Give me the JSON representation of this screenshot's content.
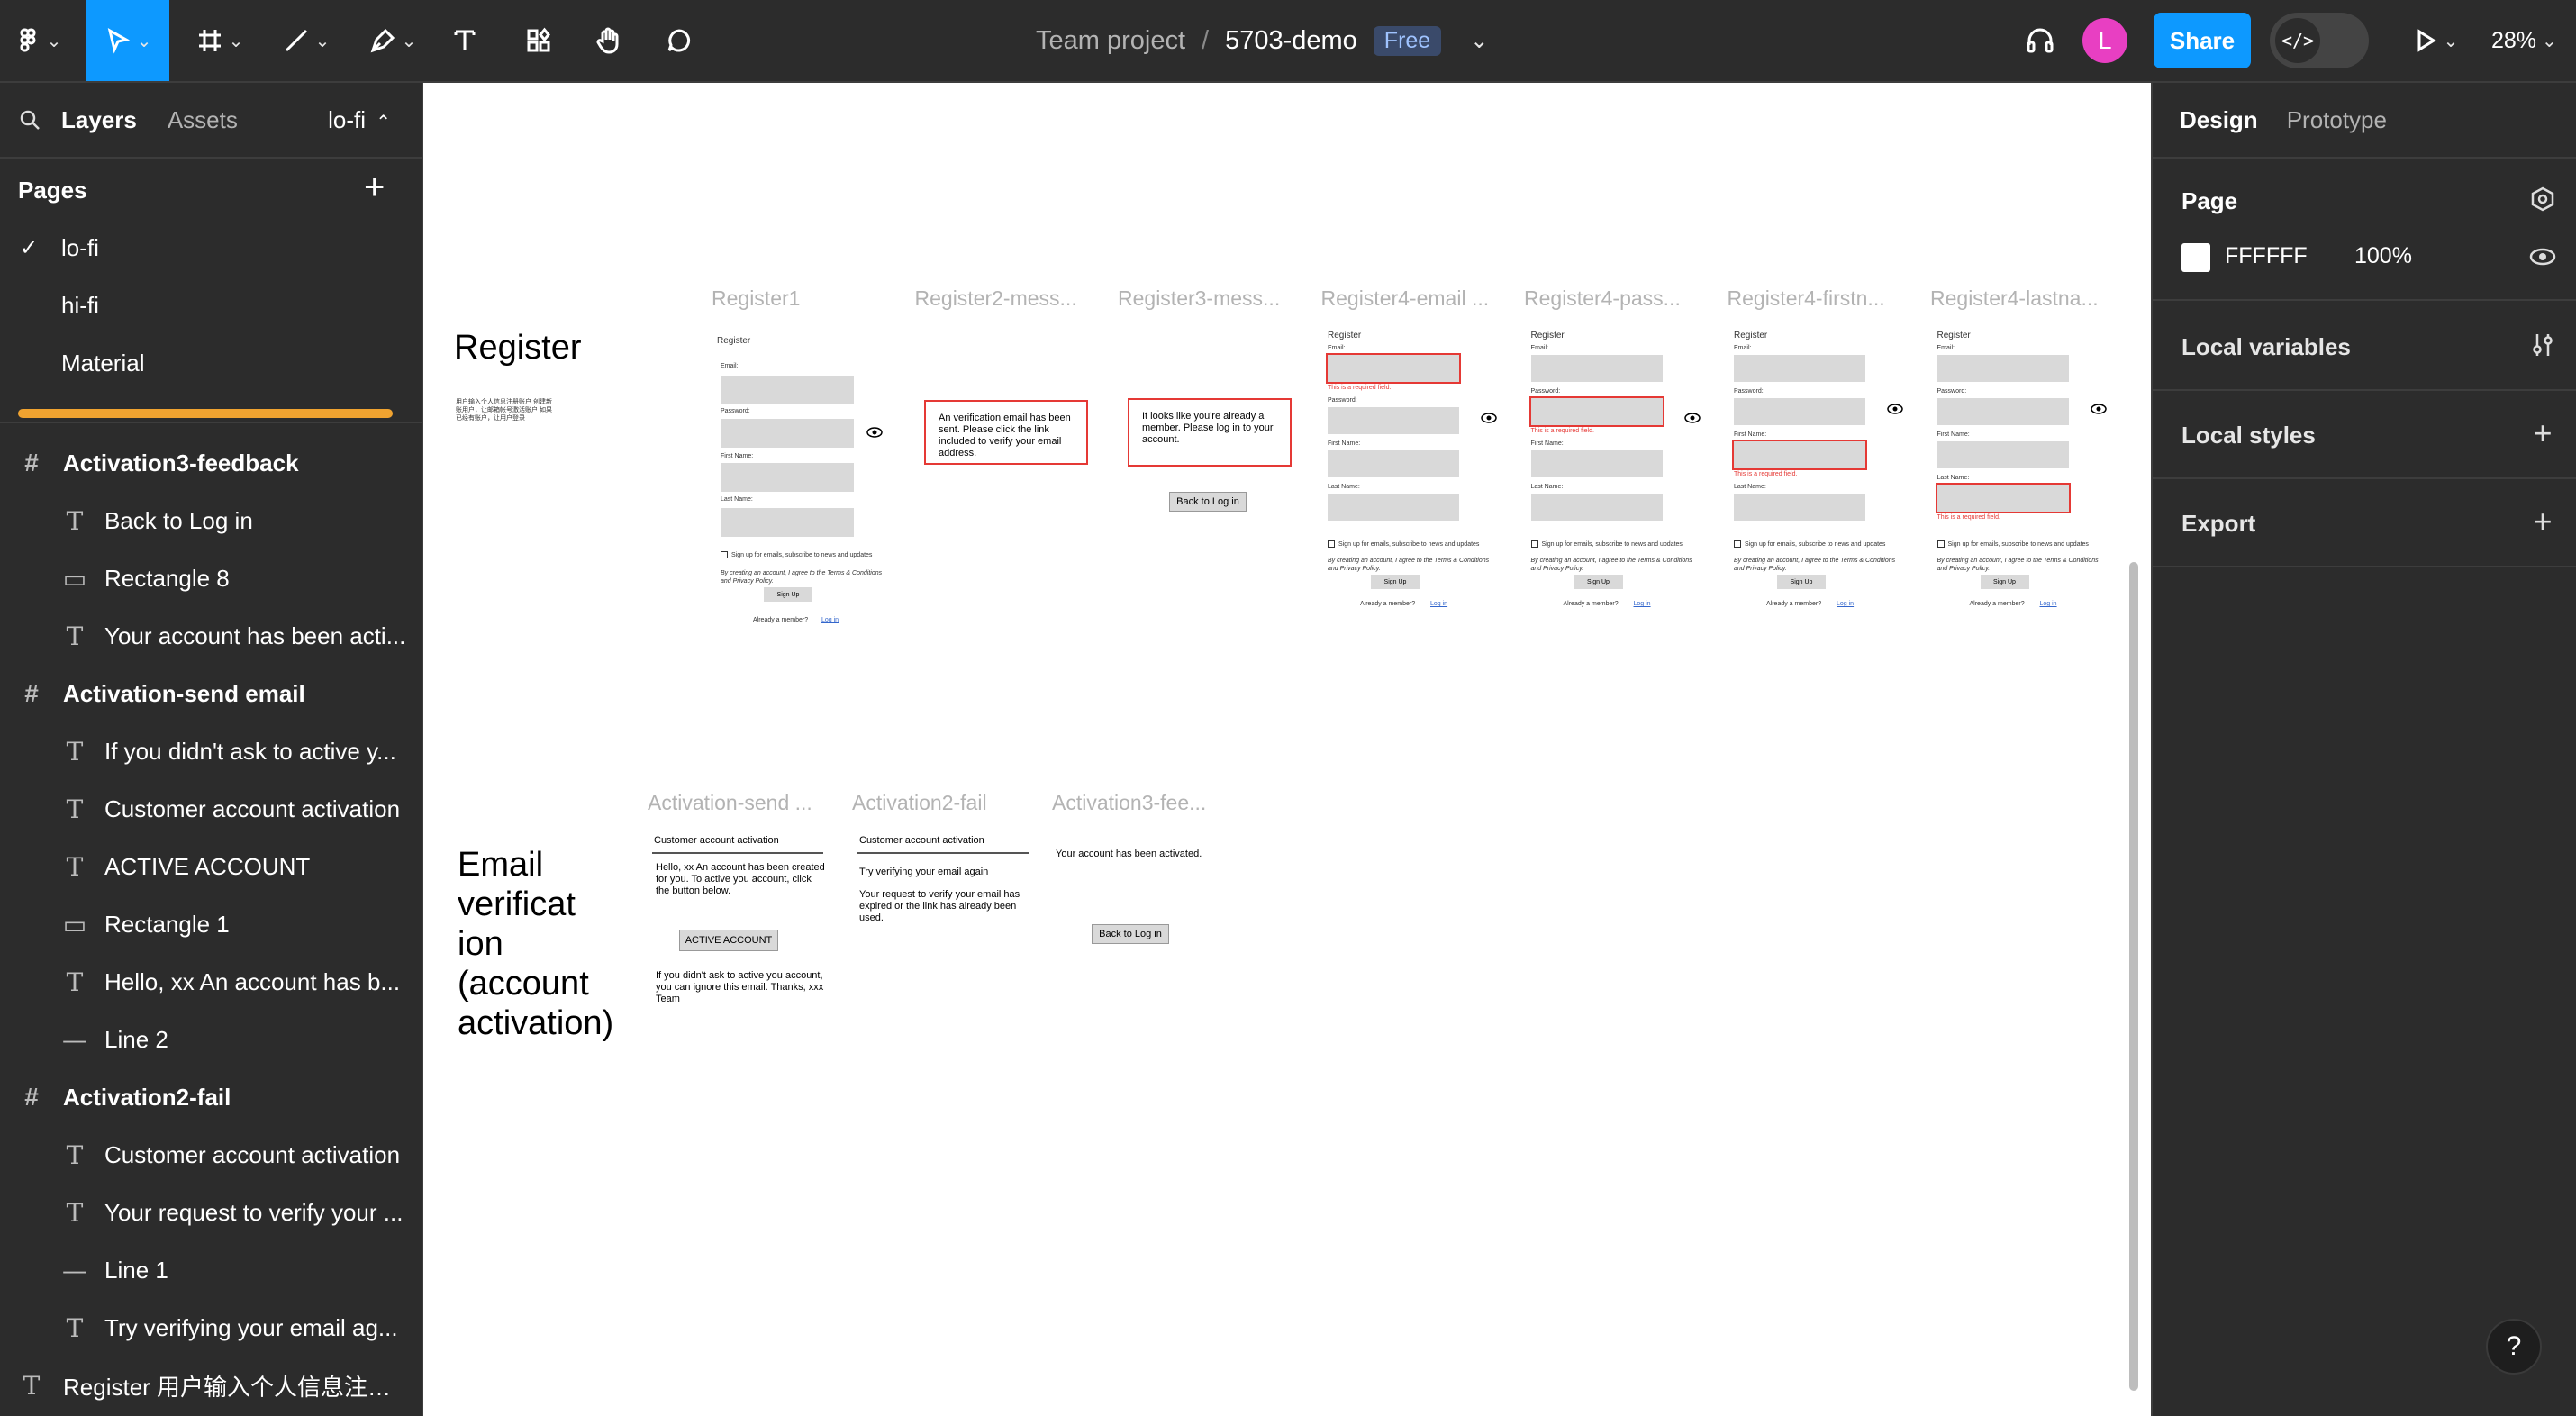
{
  "toolbar": {
    "breadcrumb_team": "Team project",
    "breadcrumb_sep": "/",
    "file_name": "5703-demo",
    "plan_badge": "Free",
    "avatar_initial": "L",
    "share_label": "Share",
    "dev_mode_label": "</>",
    "zoom_level": "28%",
    "caret": "⌄",
    "icons": [
      "main-menu-icon",
      "move-tool-icon",
      "frame-tool-icon",
      "line-tool-icon",
      "pen-tool-icon",
      "text-tool-icon",
      "resources-icon",
      "hand-tool-icon",
      "comment-icon",
      "headphones-icon",
      "present-icon"
    ]
  },
  "left_panel": {
    "tab_layers": "Layers",
    "tab_assets": "Assets",
    "current_page": "lo-fi",
    "current_page_caret": "⌃",
    "pages_heading": "Pages",
    "add_page": "+",
    "pages": [
      {
        "label": "lo-fi",
        "selected": true
      },
      {
        "label": "hi-fi",
        "selected": false
      },
      {
        "label": "Material",
        "selected": false
      }
    ],
    "layers": [
      {
        "type": "frame",
        "label": "Activation3-feedback"
      },
      {
        "type": "text",
        "label": "Back to Log in"
      },
      {
        "type": "rect",
        "label": "Rectangle 8"
      },
      {
        "type": "text",
        "label": "Your account has been acti..."
      },
      {
        "type": "frame",
        "label": "Activation-send email"
      },
      {
        "type": "text",
        "label": "If you didn't ask to active y..."
      },
      {
        "type": "text",
        "label": "Customer account activation"
      },
      {
        "type": "text",
        "label": "ACTIVE ACCOUNT"
      },
      {
        "type": "rect",
        "label": "Rectangle 1"
      },
      {
        "type": "text",
        "label": "Hello, xx An account has b..."
      },
      {
        "type": "line",
        "label": "Line 2"
      },
      {
        "type": "frame",
        "label": "Activation2-fail"
      },
      {
        "type": "text",
        "label": "Customer account activation"
      },
      {
        "type": "text",
        "label": "Your request to verify your ..."
      },
      {
        "type": "line",
        "label": "Line 1"
      },
      {
        "type": "text",
        "label": "Try verifying your email ag..."
      },
      {
        "type": "roottext",
        "label": "Register 用户输入个人信息注册..."
      }
    ]
  },
  "canvas": {
    "register_title": "Register",
    "register_note": "用户输入个人信息注册账户 创建新账用户，让邮箱帐号激活账户 如果已经有账户，让用户登录",
    "email_title": "Email verificat ion (account activation)",
    "register_frames": [
      "Register1",
      "Register2-mess...",
      "Register3-mess...",
      "Register4-email ...",
      "Register4-pass...",
      "Register4-firstn...",
      "Register4-lastna..."
    ],
    "activation_frames": [
      "Activation-send ...",
      "Activation2-fail",
      "Activation3-fee..."
    ],
    "form": {
      "heading": "Register",
      "email": "Email:",
      "password": "Password:",
      "first_name": "First Name:",
      "last_name": "Last Name:",
      "checkbox": "Sign up for emails, subscribe to news and updates",
      "terms": "By creating an account, I agree to the Terms & Conditions and Privacy Policy.",
      "signup": "Sign Up",
      "already": "Already a member?",
      "login": "Log in",
      "required": "This is a required field."
    },
    "msg_sent": "An verification email has been sent. Please click the link included to verify your email address.",
    "msg_member": "It looks like you're already a member. Please log in to your account.",
    "back_to_login": "Back to Log in",
    "act_send": {
      "header": "Customer account activation",
      "body": "Hello, xx An account has been created for you. To active you account, click the button below.",
      "button": "ACTIVE ACCOUNT",
      "footer": "If you didn't ask to active you account, you can ignore this email. Thanks, xxx Team"
    },
    "act_fail": {
      "header": "Customer account activation",
      "line1": "Try verifying your email again",
      "line2": "Your request to verify your email has expired or the link has already been used."
    },
    "act_feedback": {
      "message": "Your account has been activated.",
      "button": "Back to Log in"
    }
  },
  "right_panel": {
    "tab_design": "Design",
    "tab_prototype": "Prototype",
    "page_heading": "Page",
    "bg_hex": "FFFFFF",
    "bg_opacity": "100%",
    "bg_color": "#FFFFFF",
    "local_variables": "Local variables",
    "local_styles": "Local styles",
    "export": "Export",
    "add": "+",
    "help": "?"
  },
  "colors": {
    "accent": "#0d99ff",
    "panel_bg": "#2c2c2c",
    "scroll_highlight": "#f0a330",
    "error": "#e53935",
    "avatar": "#e83fc2"
  }
}
